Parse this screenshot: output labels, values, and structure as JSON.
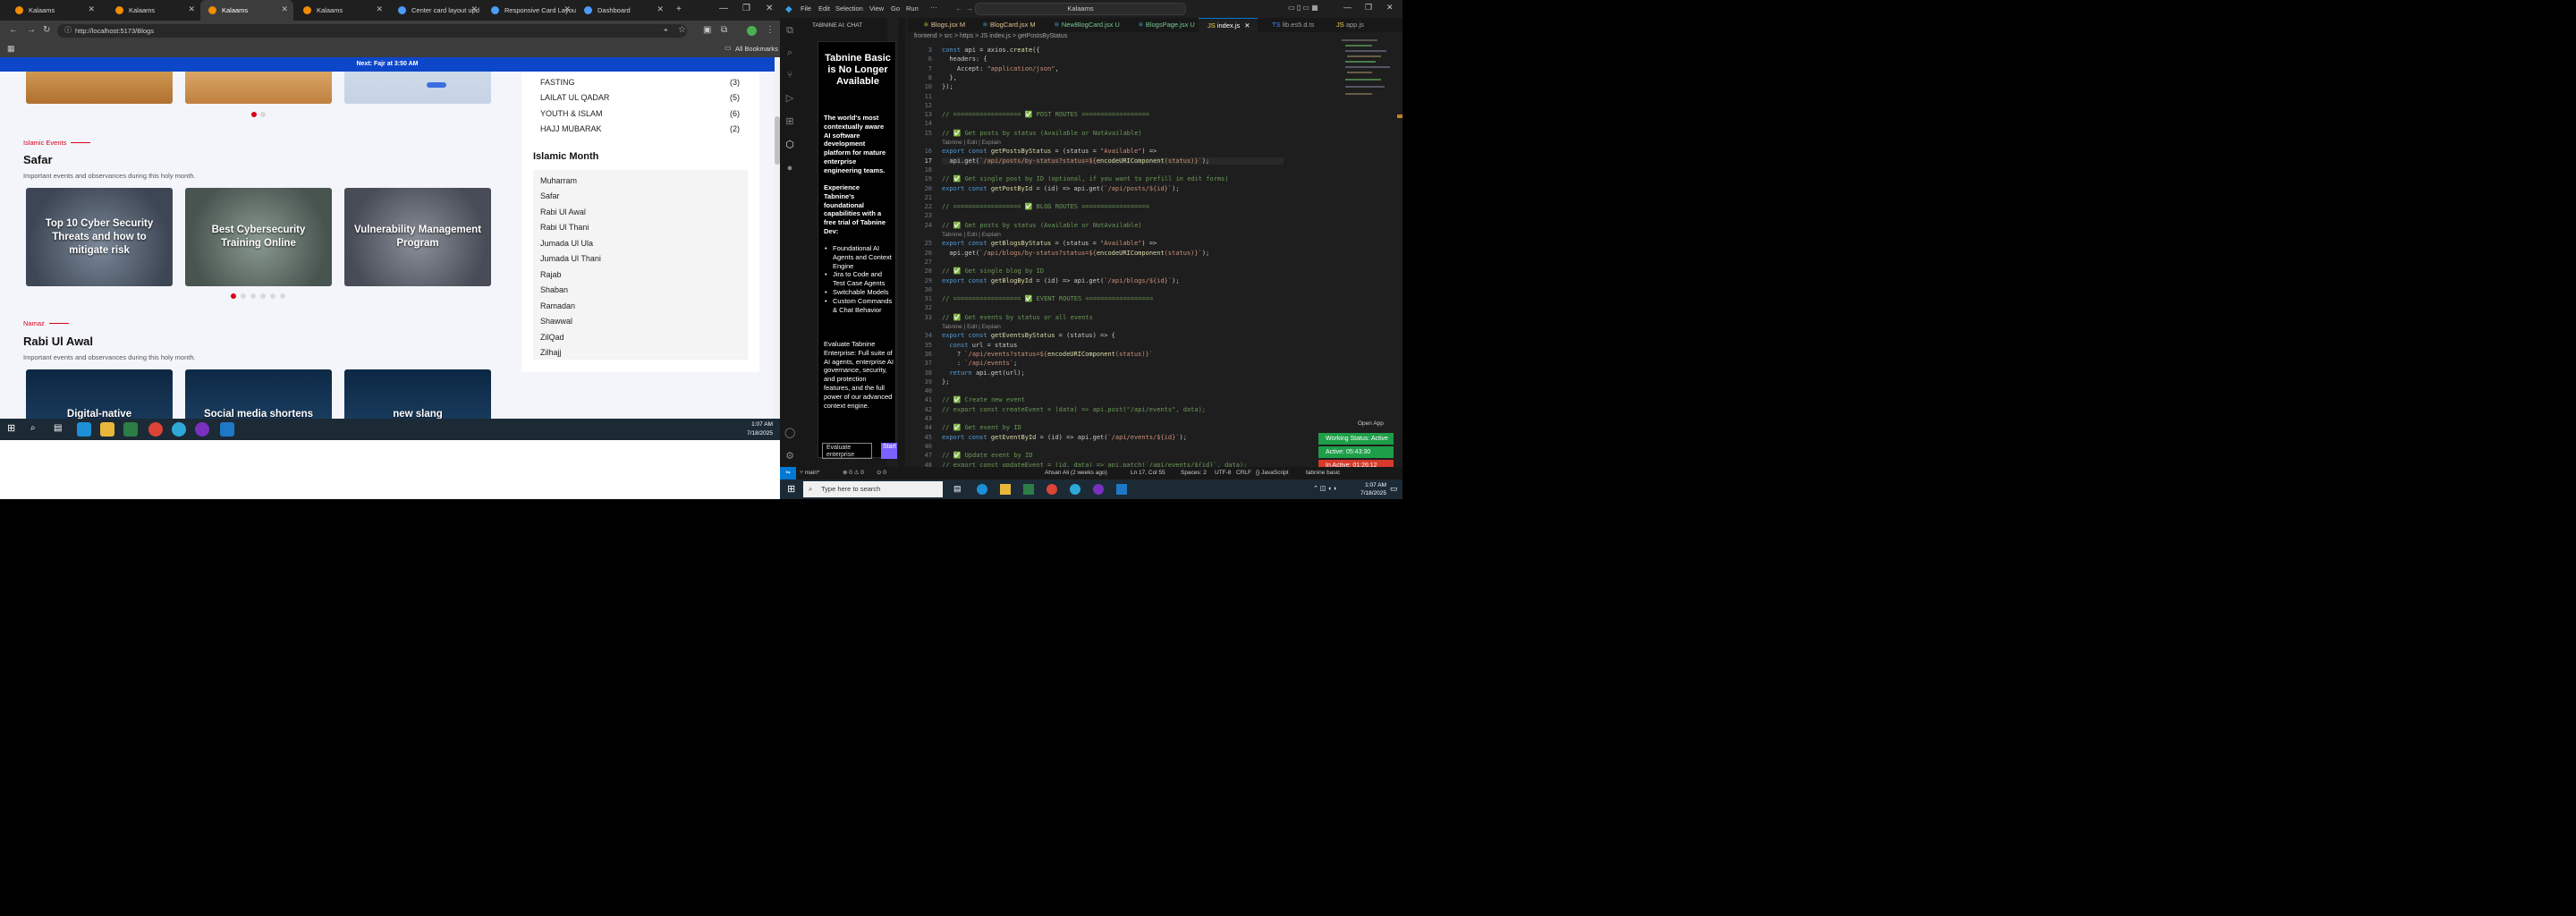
{
  "browser": {
    "tabs": [
      {
        "label": "Kalaams"
      },
      {
        "label": "Kalaams"
      },
      {
        "label": "Kalaams"
      },
      {
        "label": "Kalaams"
      },
      {
        "label": "Center card layout upd"
      },
      {
        "label": "Responsive Card Layout"
      },
      {
        "label": "Dashboard"
      }
    ],
    "url": "http://localhost:5173/Blogs",
    "all_bookmarks": "All Bookmarks"
  },
  "site": {
    "notice": "Next: Fajr at 3:50 AM",
    "sections": [
      {
        "category": "Islamic Events",
        "title": "Safar",
        "subtitle": "Important events and observances during this holy month.",
        "cards": [
          {
            "title": "Top 10 Cyber Security Threats and how to mitigate risk"
          },
          {
            "title": "Best Cybersecurity Training Online"
          },
          {
            "title": "Vulnerability Management Program"
          }
        ]
      },
      {
        "category": "Namaz",
        "title": "Rabi Ul Awal",
        "subtitle": "Important events and observances during this holy month.",
        "cards": [
          {
            "title": "Digital-native"
          },
          {
            "title": "Social media shortens"
          },
          {
            "title": "new slang"
          }
        ]
      }
    ],
    "categories": [
      {
        "name": "FASTING",
        "count": "(3)"
      },
      {
        "name": "LAILAT UL QADAR",
        "count": "(5)"
      },
      {
        "name": "YOUTH & ISLAM",
        "count": "(6)"
      },
      {
        "name": "HAJJ MUBARAK",
        "count": "(2)"
      }
    ],
    "islamic_month_title": "Islamic Month",
    "months": [
      "Muharram",
      "Safar",
      "Rabi Ul Awal",
      "Rabi Ul Thani",
      "Jumada Ul Ula",
      "Jumada Ul Thani",
      "Rajab",
      "Shaban",
      "Ramadan",
      "Shawwal",
      "ZilQad",
      "Zilhajj"
    ]
  },
  "taskbar": {
    "time": "1:07 AM",
    "date": "7/18/2025"
  },
  "vscode": {
    "menu": [
      "File",
      "Edit",
      "Selection",
      "View",
      "Go",
      "Run"
    ],
    "search": "Kalaams",
    "panel_title": "TABNINE AI: CHAT",
    "tabnine": {
      "heading": "Tabnine Basic is No Longer Available",
      "intro": "The world's most contextually aware AI software development platform for mature enterprise engineering teams.",
      "experience": "Experience Tabnine's foundational capabilities with a free trial of Tabnine Dev:",
      "features": [
        "Foundational AI Agents and Context Engine",
        "Jira to Code and Test Case Agents",
        "Switchable Models",
        "Custom Commands & Chat Behavior"
      ],
      "evaluate": "Evaluate Tabnine Enterprise: Full suite of AI agents, enterprise AI governance, security, and protection features, and the full power of our advanced context engine.",
      "btn_evaluate": "Evaluate enterprise",
      "btn_trial": "Start your Dev trial"
    },
    "tabs": [
      "Blogs.jsx M",
      "BlogCard.jsx M",
      "NewBlogCard.jsx U",
      "BlogsPage.jsx U",
      "index.js",
      "lib.es5.d.ts",
      "app.js"
    ],
    "breadcrumb": "frontend > src > https > JS index.js > getPostsByStatus",
    "lines": [
      {
        "n": "3",
        "t": "const api = axios.create({"
      },
      {
        "n": "6",
        "t": "  headers: {"
      },
      {
        "n": "7",
        "t": "    Accept: \"application/json\","
      },
      {
        "n": "8",
        "t": "  },"
      },
      {
        "n": "10",
        "t": "});"
      },
      {
        "n": "11",
        "t": ""
      },
      {
        "n": "12",
        "t": ""
      },
      {
        "n": "13",
        "t": "// ================== ✅ POST ROUTES =================="
      },
      {
        "n": "14",
        "t": ""
      },
      {
        "n": "15",
        "t": "// ✅ Get posts by status (Available or NotAvailable)"
      },
      {
        "n": "",
        "t": "Tabnine | Edit | Explain"
      },
      {
        "n": "16",
        "t": "export const getPostsByStatus = (status = \"Available\") =>"
      },
      {
        "n": "17",
        "t": "  api.get(`/api/posts/by-status?status=${encodeURIComponent(status)}`);"
      },
      {
        "n": "18",
        "t": ""
      },
      {
        "n": "19",
        "t": "// ✅ Get single post by ID (optional, if you want to prefill in edit forms)"
      },
      {
        "n": "20",
        "t": "export const getPostById = (id) => api.get(`/api/posts/${id}`);"
      },
      {
        "n": "21",
        "t": ""
      },
      {
        "n": "22",
        "t": "// ================== ✅ BLOG ROUTES =================="
      },
      {
        "n": "23",
        "t": ""
      },
      {
        "n": "24",
        "t": "// ✅ Get posts by status (Available or NotAvailable)"
      },
      {
        "n": "",
        "t": "Tabnine | Edit | Explain"
      },
      {
        "n": "25",
        "t": "export const getBlogsByStatus = (status = \"Available\") =>"
      },
      {
        "n": "26",
        "t": "  api.get(`/api/blogs/by-status?status=${encodeURIComponent(status)}`);"
      },
      {
        "n": "27",
        "t": ""
      },
      {
        "n": "28",
        "t": "// ✅ Get single blog by ID"
      },
      {
        "n": "29",
        "t": "export const getBlogById = (id) => api.get(`/api/blogs/${id}`);"
      },
      {
        "n": "30",
        "t": ""
      },
      {
        "n": "31",
        "t": "// ================== ✅ EVENT ROUTES =================="
      },
      {
        "n": "32",
        "t": ""
      },
      {
        "n": "33",
        "t": "// ✅ Get events by status or all events"
      },
      {
        "n": "",
        "t": "Tabnine | Edit | Explain"
      },
      {
        "n": "34",
        "t": "export const getEventsByStatus = (status) => {"
      },
      {
        "n": "35",
        "t": "  const url = status"
      },
      {
        "n": "36",
        "t": "    ? `/api/events?status=${encodeURIComponent(status)}`"
      },
      {
        "n": "37",
        "t": "    : `/api/events`;"
      },
      {
        "n": "38",
        "t": "  return api.get(url);"
      },
      {
        "n": "39",
        "t": "};"
      },
      {
        "n": "40",
        "t": ""
      },
      {
        "n": "41",
        "t": "// ✅ Create new event"
      },
      {
        "n": "42",
        "t": "// export const createEvent = (data) => api.post(\"/api/events\", data);"
      },
      {
        "n": "43",
        "t": ""
      },
      {
        "n": "44",
        "t": "// ✅ Get event by ID"
      },
      {
        "n": "45",
        "t": "export const getEventById = (id) => api.get(`/api/events/${id}`);"
      },
      {
        "n": "46",
        "t": ""
      },
      {
        "n": "47",
        "t": "// ✅ Update event by ID"
      },
      {
        "n": "48",
        "t": "// export const updateEvent = (id, data) => api.patch(`/api/events/${id}`, data);"
      }
    ],
    "open_app": "Open App",
    "working_status": "Working Status: Active",
    "active": "Active: 05:43:30",
    "inactive": "In Active: 01:26:12",
    "status_bar": {
      "branch": "main*",
      "problems": "⊗ 0 ⚠ 0",
      "ports": "0",
      "blame": "Ahsan Ali (2 weeks ago)",
      "position": "Ln 17, Col 55",
      "spaces": "Spaces: 2",
      "encoding": "UTF-8",
      "eol": "CRLF",
      "language": "{} JavaScript",
      "tabnine": "tabnine basic"
    },
    "taskbar": {
      "search": "Type here to search",
      "time": "1:07 AM",
      "date": "7/18/2025"
    }
  }
}
